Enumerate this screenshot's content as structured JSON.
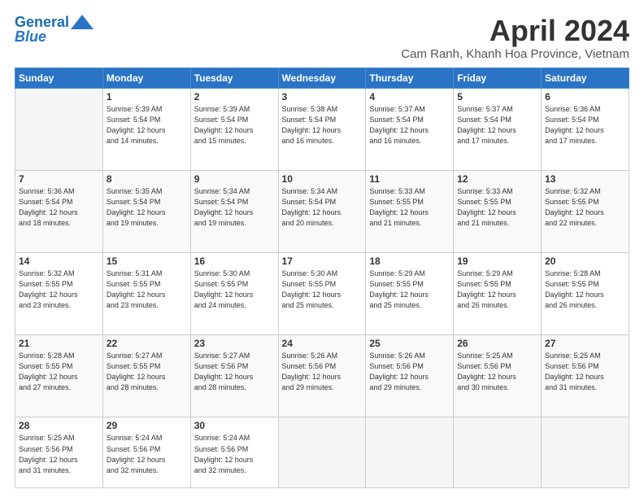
{
  "logo": {
    "line1": "General",
    "line2": "Blue"
  },
  "title": "April 2024",
  "location": "Cam Ranh, Khanh Hoa Province, Vietnam",
  "days_of_week": [
    "Sunday",
    "Monday",
    "Tuesday",
    "Wednesday",
    "Thursday",
    "Friday",
    "Saturday"
  ],
  "weeks": [
    [
      {
        "day": "",
        "info": ""
      },
      {
        "day": "1",
        "info": "Sunrise: 5:39 AM\nSunset: 5:54 PM\nDaylight: 12 hours\nand 14 minutes."
      },
      {
        "day": "2",
        "info": "Sunrise: 5:39 AM\nSunset: 5:54 PM\nDaylight: 12 hours\nand 15 minutes."
      },
      {
        "day": "3",
        "info": "Sunrise: 5:38 AM\nSunset: 5:54 PM\nDaylight: 12 hours\nand 16 minutes."
      },
      {
        "day": "4",
        "info": "Sunrise: 5:37 AM\nSunset: 5:54 PM\nDaylight: 12 hours\nand 16 minutes."
      },
      {
        "day": "5",
        "info": "Sunrise: 5:37 AM\nSunset: 5:54 PM\nDaylight: 12 hours\nand 17 minutes."
      },
      {
        "day": "6",
        "info": "Sunrise: 5:36 AM\nSunset: 5:54 PM\nDaylight: 12 hours\nand 17 minutes."
      }
    ],
    [
      {
        "day": "7",
        "info": "Sunrise: 5:36 AM\nSunset: 5:54 PM\nDaylight: 12 hours\nand 18 minutes."
      },
      {
        "day": "8",
        "info": "Sunrise: 5:35 AM\nSunset: 5:54 PM\nDaylight: 12 hours\nand 19 minutes."
      },
      {
        "day": "9",
        "info": "Sunrise: 5:34 AM\nSunset: 5:54 PM\nDaylight: 12 hours\nand 19 minutes."
      },
      {
        "day": "10",
        "info": "Sunrise: 5:34 AM\nSunset: 5:54 PM\nDaylight: 12 hours\nand 20 minutes."
      },
      {
        "day": "11",
        "info": "Sunrise: 5:33 AM\nSunset: 5:55 PM\nDaylight: 12 hours\nand 21 minutes."
      },
      {
        "day": "12",
        "info": "Sunrise: 5:33 AM\nSunset: 5:55 PM\nDaylight: 12 hours\nand 21 minutes."
      },
      {
        "day": "13",
        "info": "Sunrise: 5:32 AM\nSunset: 5:55 PM\nDaylight: 12 hours\nand 22 minutes."
      }
    ],
    [
      {
        "day": "14",
        "info": "Sunrise: 5:32 AM\nSunset: 5:55 PM\nDaylight: 12 hours\nand 23 minutes."
      },
      {
        "day": "15",
        "info": "Sunrise: 5:31 AM\nSunset: 5:55 PM\nDaylight: 12 hours\nand 23 minutes."
      },
      {
        "day": "16",
        "info": "Sunrise: 5:30 AM\nSunset: 5:55 PM\nDaylight: 12 hours\nand 24 minutes."
      },
      {
        "day": "17",
        "info": "Sunrise: 5:30 AM\nSunset: 5:55 PM\nDaylight: 12 hours\nand 25 minutes."
      },
      {
        "day": "18",
        "info": "Sunrise: 5:29 AM\nSunset: 5:55 PM\nDaylight: 12 hours\nand 25 minutes."
      },
      {
        "day": "19",
        "info": "Sunrise: 5:29 AM\nSunset: 5:55 PM\nDaylight: 12 hours\nand 26 minutes."
      },
      {
        "day": "20",
        "info": "Sunrise: 5:28 AM\nSunset: 5:55 PM\nDaylight: 12 hours\nand 26 minutes."
      }
    ],
    [
      {
        "day": "21",
        "info": "Sunrise: 5:28 AM\nSunset: 5:55 PM\nDaylight: 12 hours\nand 27 minutes."
      },
      {
        "day": "22",
        "info": "Sunrise: 5:27 AM\nSunset: 5:55 PM\nDaylight: 12 hours\nand 28 minutes."
      },
      {
        "day": "23",
        "info": "Sunrise: 5:27 AM\nSunset: 5:56 PM\nDaylight: 12 hours\nand 28 minutes."
      },
      {
        "day": "24",
        "info": "Sunrise: 5:26 AM\nSunset: 5:56 PM\nDaylight: 12 hours\nand 29 minutes."
      },
      {
        "day": "25",
        "info": "Sunrise: 5:26 AM\nSunset: 5:56 PM\nDaylight: 12 hours\nand 29 minutes."
      },
      {
        "day": "26",
        "info": "Sunrise: 5:25 AM\nSunset: 5:56 PM\nDaylight: 12 hours\nand 30 minutes."
      },
      {
        "day": "27",
        "info": "Sunrise: 5:25 AM\nSunset: 5:56 PM\nDaylight: 12 hours\nand 31 minutes."
      }
    ],
    [
      {
        "day": "28",
        "info": "Sunrise: 5:25 AM\nSunset: 5:56 PM\nDaylight: 12 hours\nand 31 minutes."
      },
      {
        "day": "29",
        "info": "Sunrise: 5:24 AM\nSunset: 5:56 PM\nDaylight: 12 hours\nand 32 minutes."
      },
      {
        "day": "30",
        "info": "Sunrise: 5:24 AM\nSunset: 5:56 PM\nDaylight: 12 hours\nand 32 minutes."
      },
      {
        "day": "",
        "info": ""
      },
      {
        "day": "",
        "info": ""
      },
      {
        "day": "",
        "info": ""
      },
      {
        "day": "",
        "info": ""
      }
    ]
  ]
}
